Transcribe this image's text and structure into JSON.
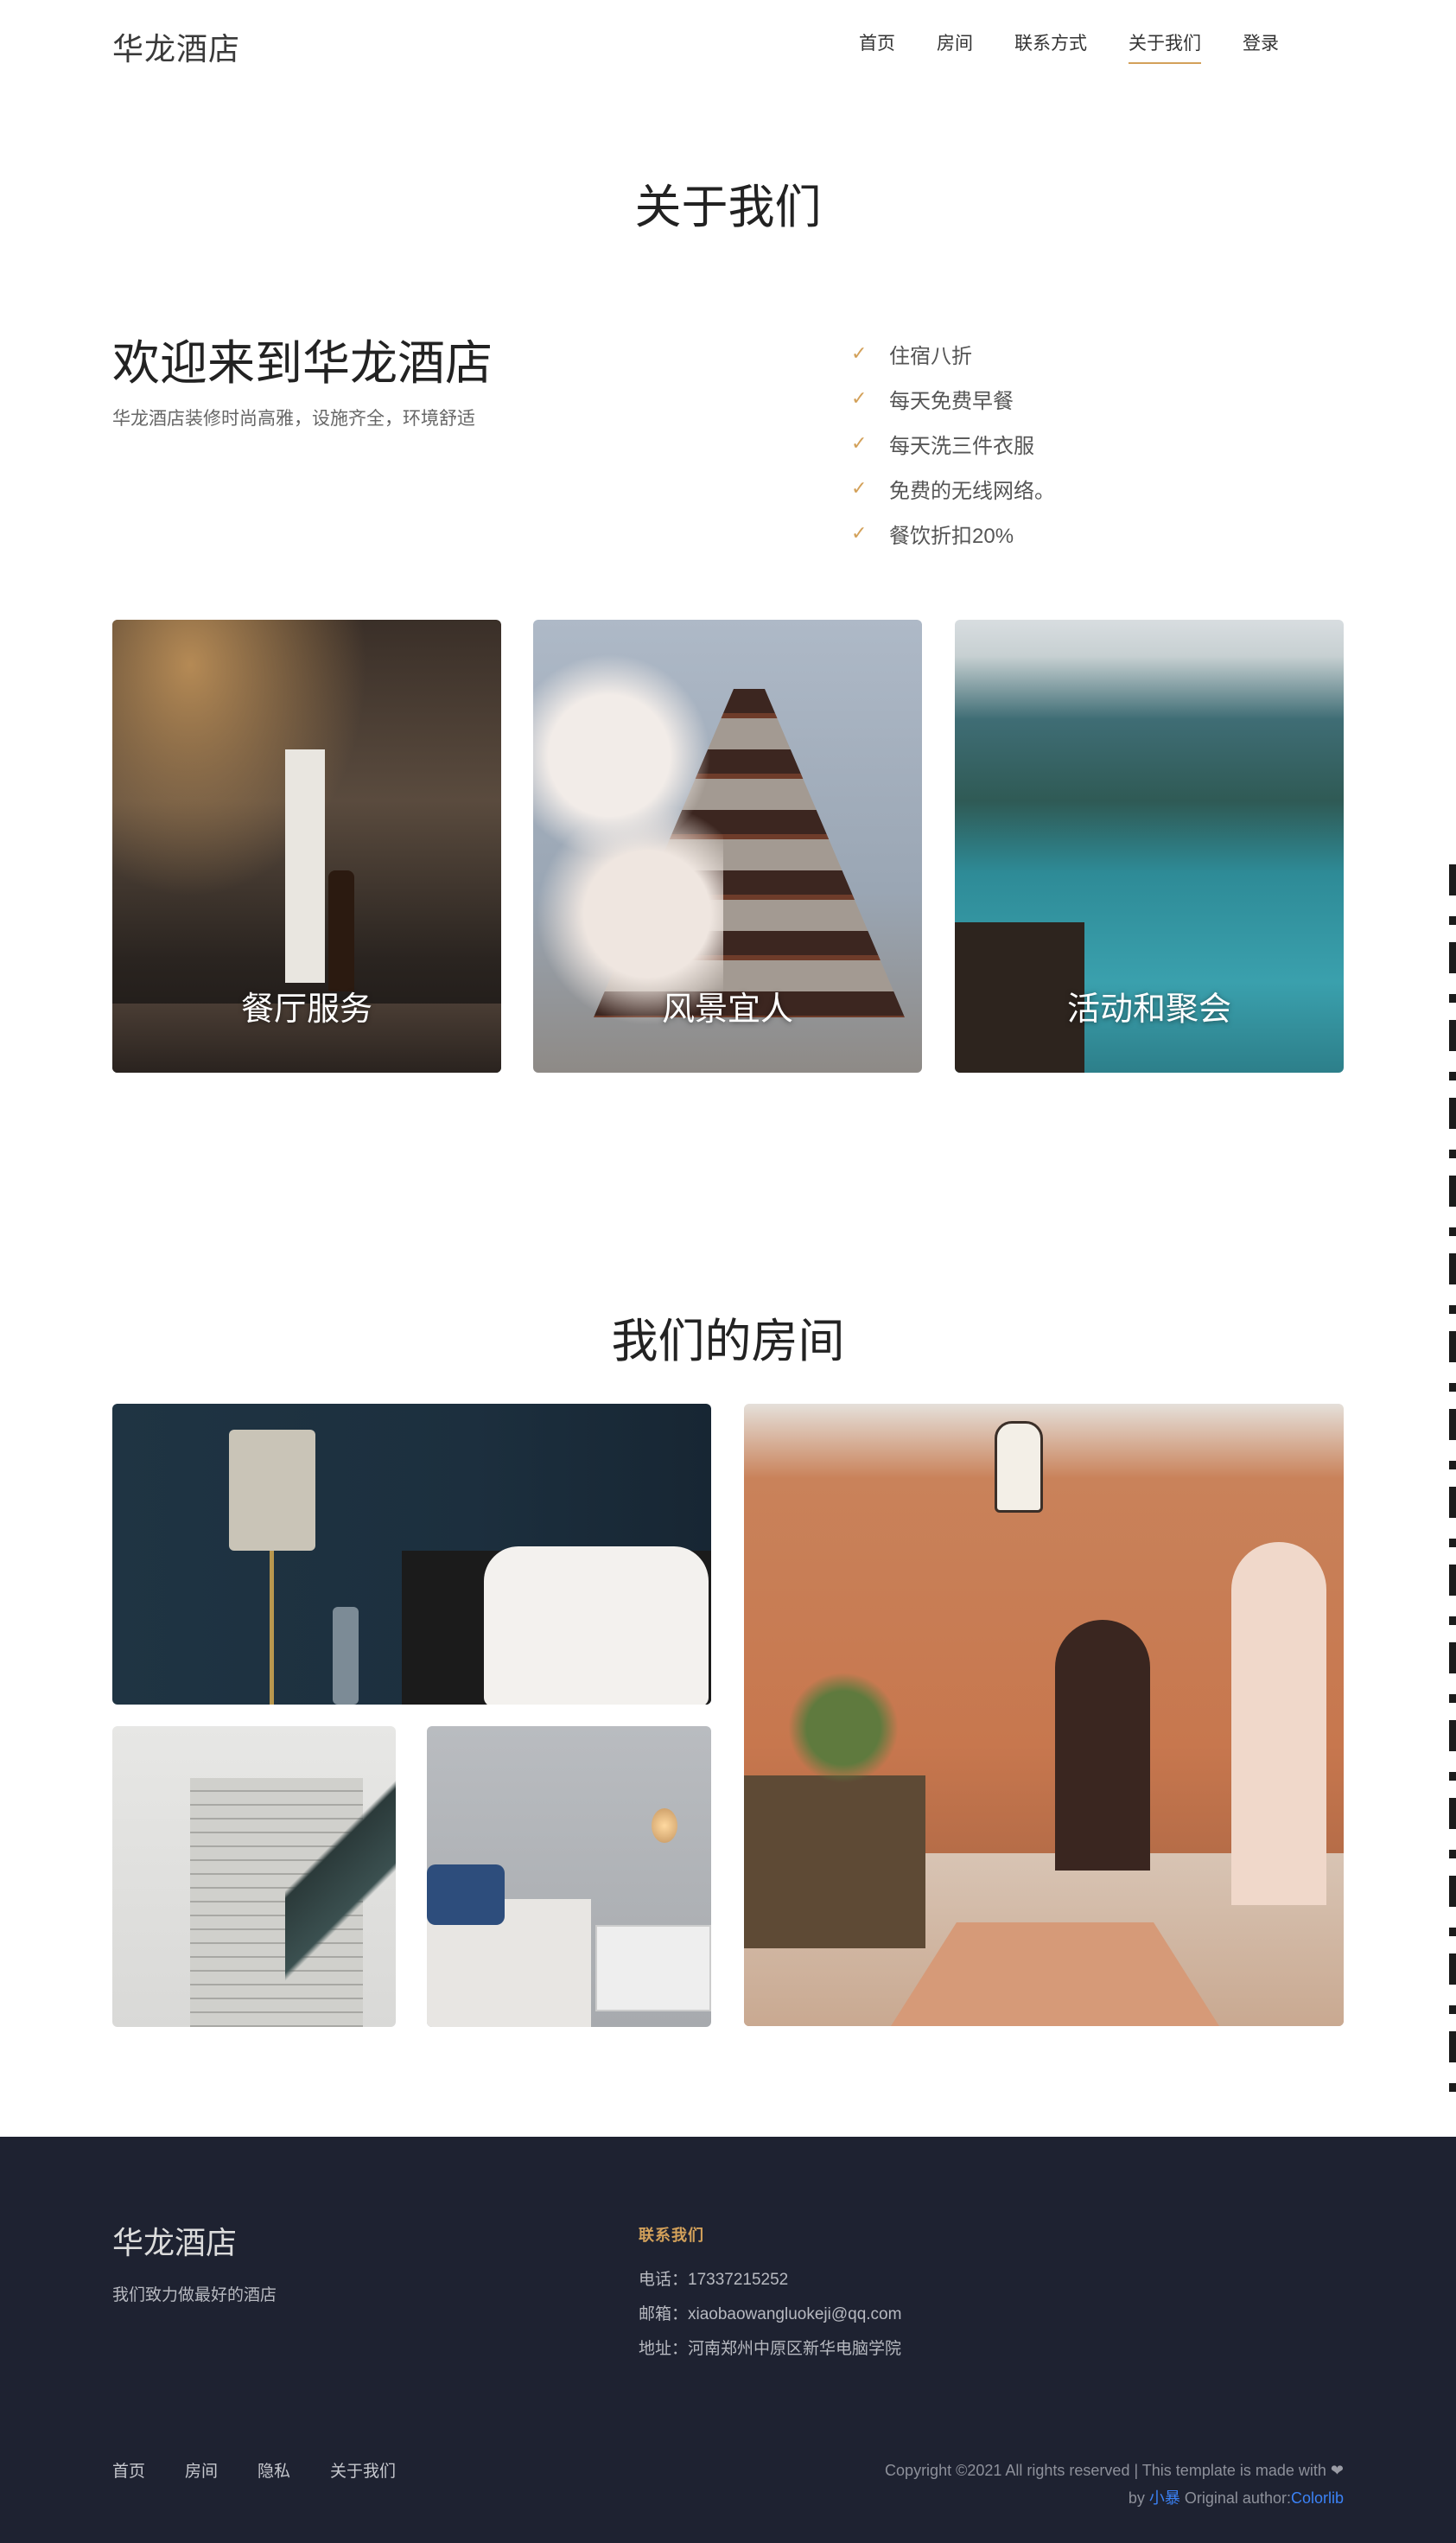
{
  "header": {
    "brand": "华龙酒店",
    "nav": [
      {
        "label": "首页"
      },
      {
        "label": "房间"
      },
      {
        "label": "联系方式"
      },
      {
        "label": "关于我们"
      },
      {
        "label": "登录"
      }
    ],
    "active_nav": "关于我们",
    "accent_color": "#d3a15a"
  },
  "about": {
    "title": "关于我们",
    "welcome": "欢迎来到华龙酒店",
    "welcome_sub": "华龙酒店装修时尚高雅，设施齐全，环境舒适",
    "features": [
      "住宿八折",
      "每天免费早餐",
      "每天洗三件衣服",
      "免费的无线网络。",
      "餐饮折扣20%"
    ],
    "check_icon": "check-icon"
  },
  "cards": [
    {
      "label": "餐厅服务"
    },
    {
      "label": "风景宜人"
    },
    {
      "label": "活动和聚会"
    }
  ],
  "rooms": {
    "title": "我们的房间"
  },
  "footer": {
    "brand": "华龙酒店",
    "tagline": "我们致力做最好的酒店",
    "contact_title": "联系我们",
    "phone": "电话：17337215252",
    "email": "邮箱：xiaobaowangluokeji@qq.com",
    "address": "地址：河南郑州中原区新华电脑学院",
    "links": [
      {
        "label": "首页"
      },
      {
        "label": "房间"
      },
      {
        "label": "隐私"
      },
      {
        "label": "关于我们"
      }
    ],
    "copyright_line1": "Copyright ©2021 All rights reserved | This template is made with",
    "heart_icon": "heart-icon",
    "by": "by",
    "author": "小暴",
    "original": "Original author:",
    "original_author": "Colorlib",
    "background_color": "#1e2231"
  }
}
